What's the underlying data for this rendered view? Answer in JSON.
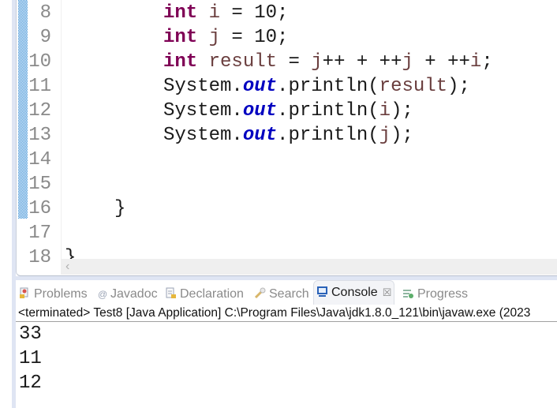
{
  "editor": {
    "lines": [
      {
        "num": "8",
        "indent": "        ",
        "tokens": [
          {
            "t": "kw",
            "v": "int"
          },
          {
            "t": "plain",
            "v": " "
          },
          {
            "t": "var",
            "v": "i"
          },
          {
            "t": "plain",
            "v": " = 10;"
          }
        ]
      },
      {
        "num": "9",
        "indent": "        ",
        "tokens": [
          {
            "t": "kw",
            "v": "int"
          },
          {
            "t": "plain",
            "v": " "
          },
          {
            "t": "var",
            "v": "j"
          },
          {
            "t": "plain",
            "v": " = 10;"
          }
        ]
      },
      {
        "num": "10",
        "indent": "        ",
        "tokens": [
          {
            "t": "kw",
            "v": "int"
          },
          {
            "t": "plain",
            "v": " "
          },
          {
            "t": "var",
            "v": "result"
          },
          {
            "t": "plain",
            "v": " = "
          },
          {
            "t": "var",
            "v": "j"
          },
          {
            "t": "plain",
            "v": "++ + ++"
          },
          {
            "t": "var",
            "v": "j"
          },
          {
            "t": "plain",
            "v": " + ++"
          },
          {
            "t": "var",
            "v": "i"
          },
          {
            "t": "plain",
            "v": ";"
          }
        ]
      },
      {
        "num": "11",
        "indent": "        ",
        "tokens": [
          {
            "t": "plain",
            "v": "System."
          },
          {
            "t": "field",
            "v": "out"
          },
          {
            "t": "plain",
            "v": ".println("
          },
          {
            "t": "var",
            "v": "result"
          },
          {
            "t": "plain",
            "v": ");"
          }
        ]
      },
      {
        "num": "12",
        "indent": "        ",
        "tokens": [
          {
            "t": "plain",
            "v": "System."
          },
          {
            "t": "field",
            "v": "out"
          },
          {
            "t": "plain",
            "v": ".println("
          },
          {
            "t": "var",
            "v": "i"
          },
          {
            "t": "plain",
            "v": ");"
          }
        ]
      },
      {
        "num": "13",
        "indent": "        ",
        "tokens": [
          {
            "t": "plain",
            "v": "System."
          },
          {
            "t": "field",
            "v": "out"
          },
          {
            "t": "plain",
            "v": ".println("
          },
          {
            "t": "var",
            "v": "j"
          },
          {
            "t": "plain",
            "v": ");"
          }
        ]
      },
      {
        "num": "14",
        "indent": "",
        "tokens": []
      },
      {
        "num": "15",
        "indent": "",
        "tokens": []
      },
      {
        "num": "16",
        "indent": "    ",
        "tokens": [
          {
            "t": "plain",
            "v": "}"
          }
        ]
      },
      {
        "num": "17",
        "indent": "",
        "tokens": []
      },
      {
        "num": "18",
        "indent": "",
        "tokens": [
          {
            "t": "plain",
            "v": "}"
          }
        ]
      }
    ],
    "scroll_left_glyph": "‹"
  },
  "panel": {
    "tabs": [
      {
        "label": "Problems",
        "icon": "problems-icon",
        "active": false
      },
      {
        "label": "Javadoc",
        "icon": "javadoc-icon",
        "active": false
      },
      {
        "label": "Declaration",
        "icon": "declaration-icon",
        "active": false
      },
      {
        "label": "Search",
        "icon": "search-icon",
        "active": false
      },
      {
        "label": "Console",
        "icon": "console-icon",
        "active": true,
        "close": "☒"
      },
      {
        "label": "Progress",
        "icon": "progress-icon",
        "active": false
      }
    ],
    "status": "<terminated> Test8 [Java Application] C:\\Program Files\\Java\\jdk1.8.0_121\\bin\\javaw.exe (2023",
    "output": [
      "33",
      "11",
      "12"
    ]
  },
  "colors": {
    "keyword": "#7f0055",
    "local_variable": "#6a3e3e",
    "static_field": "#0000c0",
    "line_number": "#8a8a8a"
  }
}
